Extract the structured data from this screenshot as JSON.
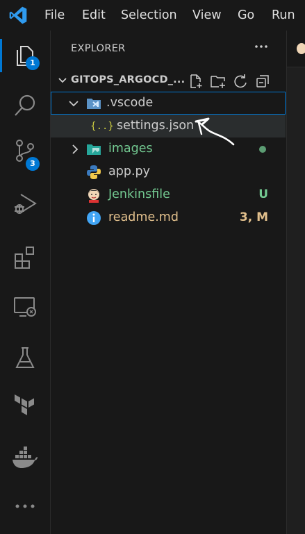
{
  "menu": {
    "items": [
      "File",
      "Edit",
      "Selection",
      "View",
      "Go",
      "Run"
    ]
  },
  "activity_bar": {
    "explorer_badge": "1",
    "source_control_badge": "3"
  },
  "sidebar": {
    "title": "EXPLORER",
    "section_title": "GITOPS_ARGOCD_...",
    "tree": [
      {
        "label": ".vscode",
        "type": "folder",
        "expanded": true,
        "selected": true,
        "color": "#cccccc"
      },
      {
        "label": "settings.json",
        "type": "file",
        "icon_text": "{..}",
        "color": "#cccccc"
      },
      {
        "label": "images",
        "type": "folder",
        "expanded": false,
        "color": "#73c991"
      },
      {
        "label": "app.py",
        "type": "file",
        "color": "#cccccc"
      },
      {
        "label": "Jenkinsfile",
        "type": "file",
        "color": "#73c991",
        "decoration": "U"
      },
      {
        "label": "readme.md",
        "type": "file",
        "color": "#e2c08d",
        "decoration": "3, M"
      }
    ]
  },
  "colors": {
    "accent": "#0078d4",
    "untracked": "#73c991",
    "modified": "#e2c08d"
  }
}
